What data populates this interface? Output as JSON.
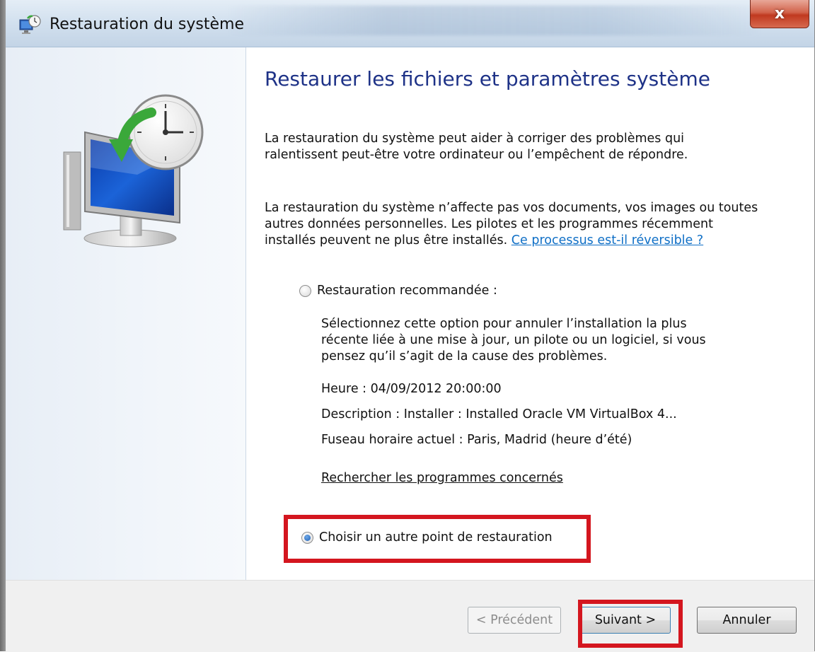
{
  "window": {
    "title": "Restauration du système",
    "close_label": "x"
  },
  "icons": {
    "title_icon": "system-restore-icon",
    "main_icon": "system-restore-monitor-clock-icon"
  },
  "content": {
    "heading": "Restaurer les fichiers et paramètres système",
    "para1": "La restauration du système peut aider à corriger des problèmes qui ralentissent peut-être votre ordinateur ou l’empêchent de répondre.",
    "para2": "La restauration du système n’affecte pas vos documents, vos images ou toutes autres données personnelles. Les pilotes et les programmes récemment installés peuvent ne plus être installés.",
    "para2_link": "Ce processus est-il réversible ?",
    "recommended": {
      "label": "Restauration recommandée :",
      "selected": false,
      "description": "Sélectionnez cette option pour annuler l’installation la plus récente liée à une mise à jour, un pilote ou un logiciel, si vous pensez qu’il s’agit de la cause des problèmes.",
      "heure": "Heure : 04/09/2012 20:00:00",
      "description_line": "Description : Installer : Installed Oracle VM VirtualBox 4...",
      "fuseau": "Fuseau horaire actuel : Paris, Madrid (heure d’été)",
      "link": "Rechercher les programmes concernés"
    },
    "other_point": {
      "label": "Choisir un autre point de restauration",
      "selected": true
    }
  },
  "buttons": {
    "previous": "< Précédent",
    "next": "Suivant >",
    "cancel": "Annuler"
  },
  "colors": {
    "heading": "#1e3287",
    "link": "#0f6fc6",
    "highlight": "#d4161f"
  }
}
